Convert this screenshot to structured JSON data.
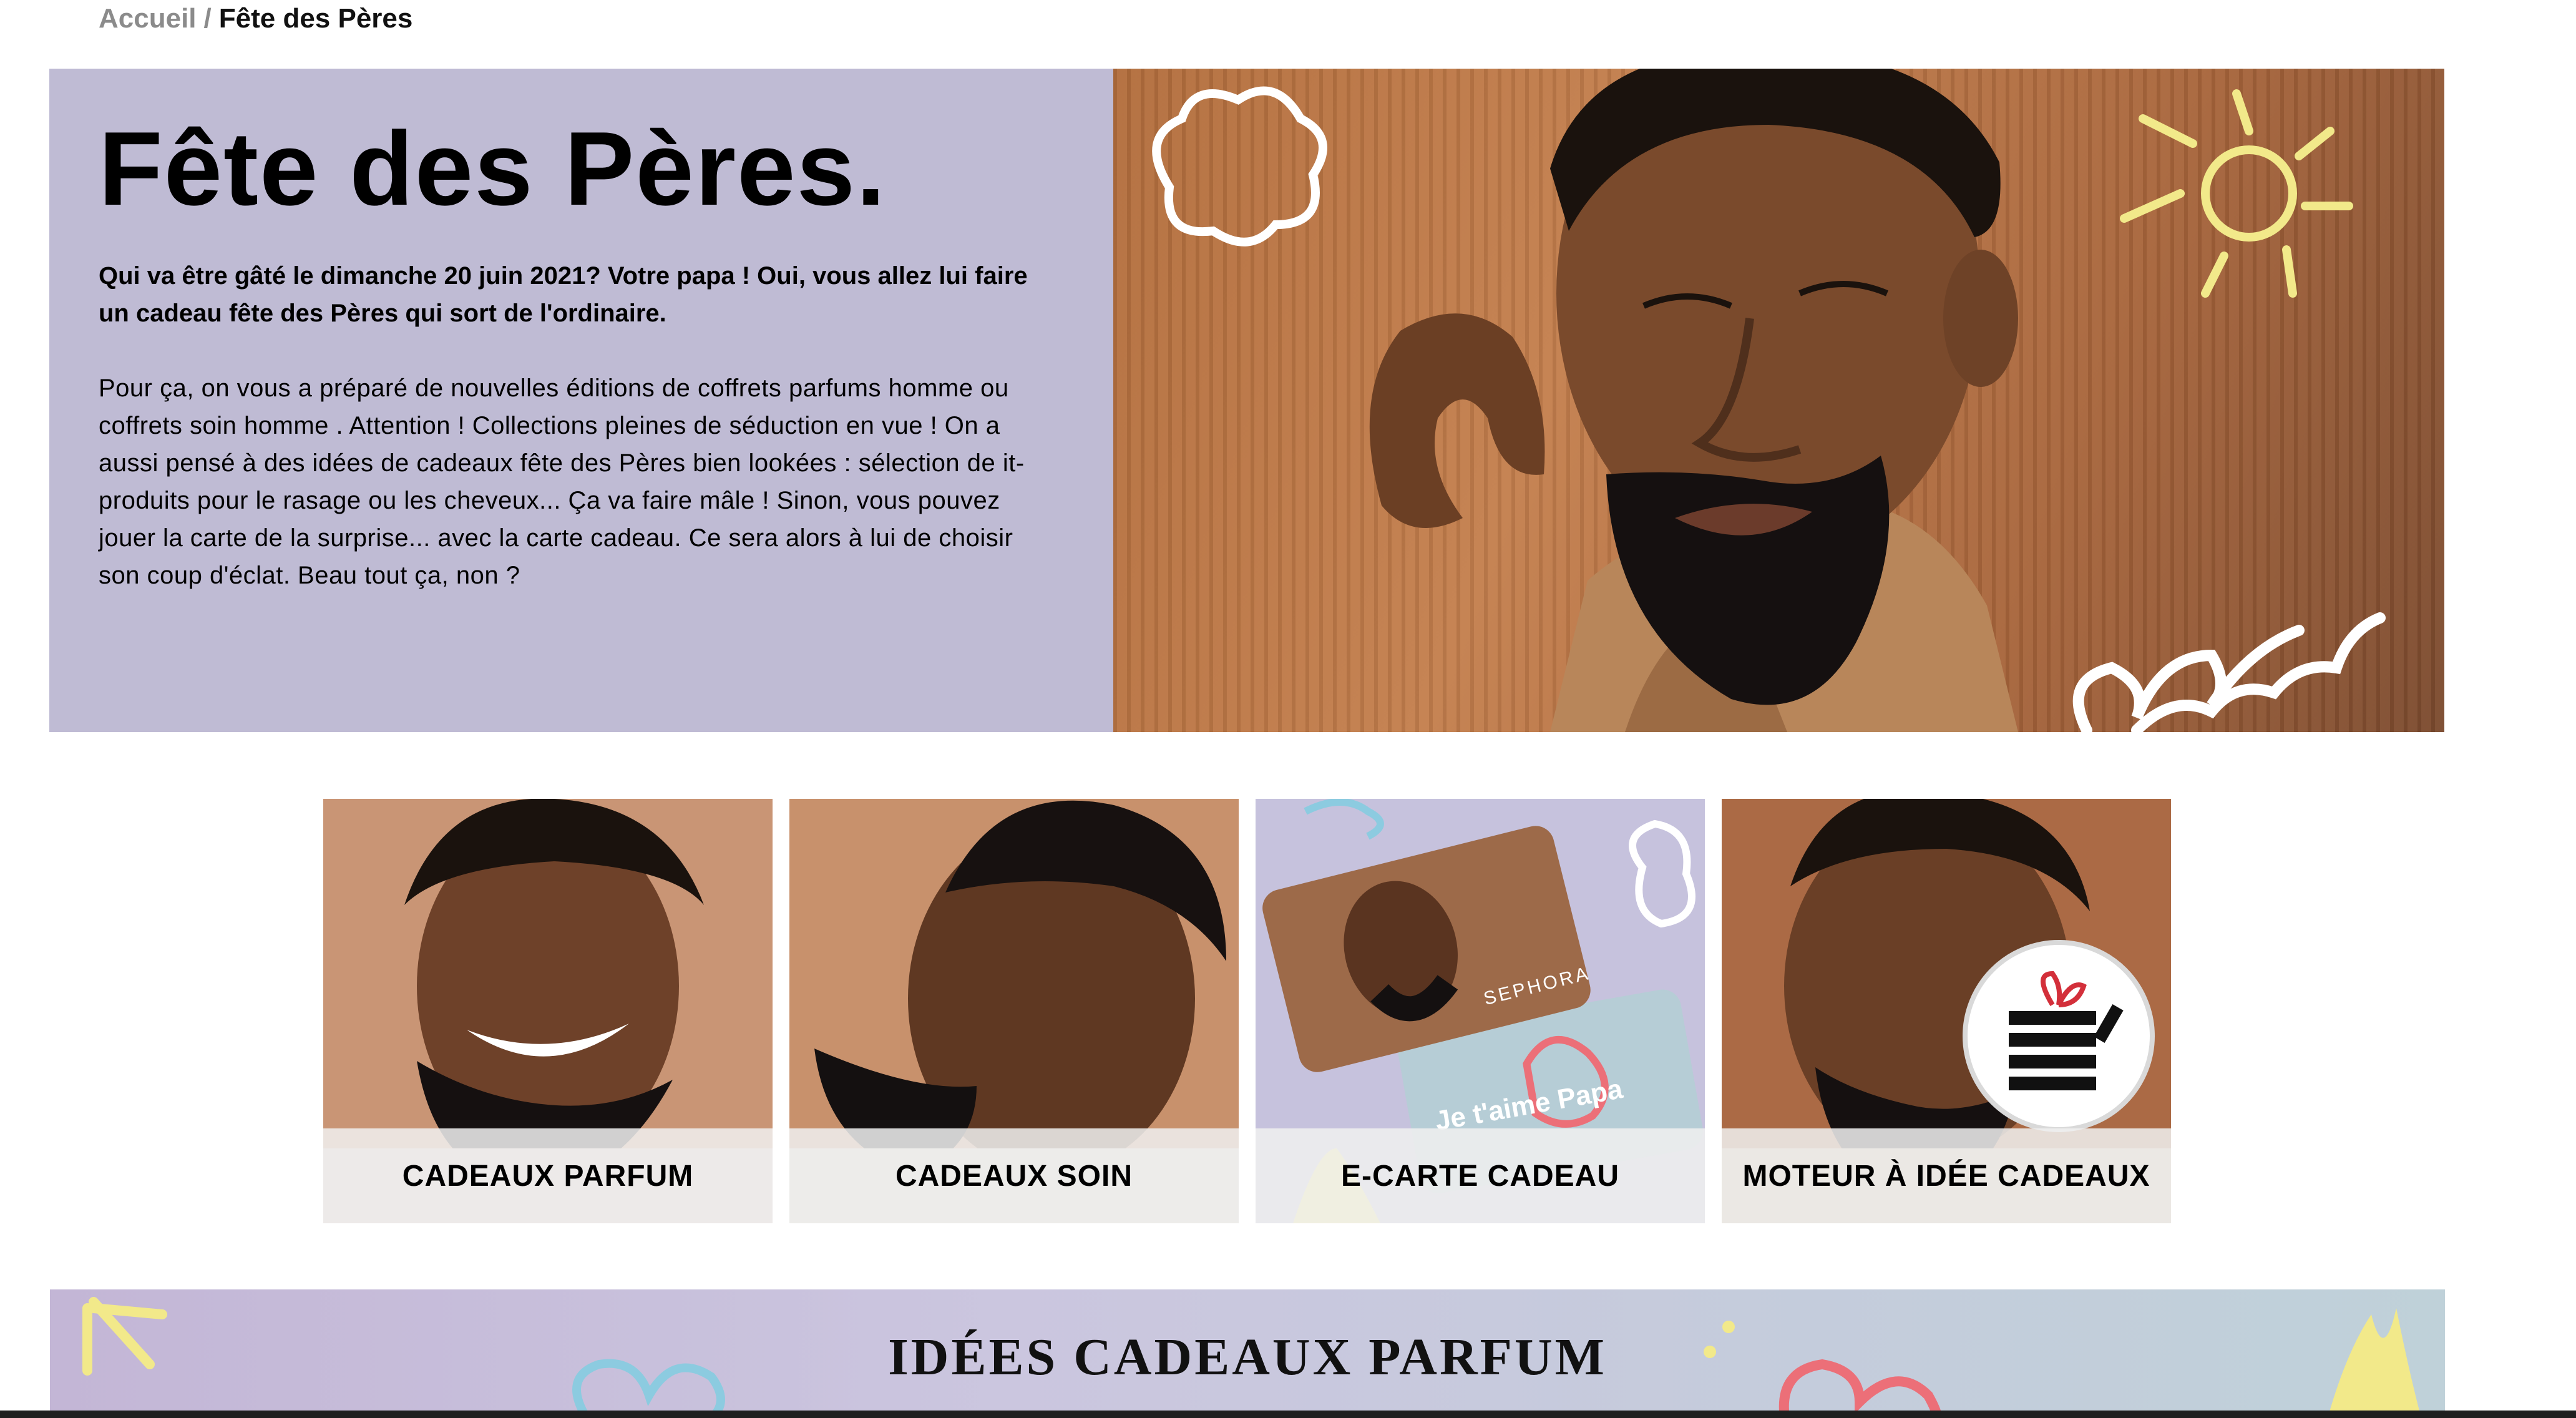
{
  "breadcrumb": {
    "home": "Accueil",
    "separator": "/",
    "current": "Fête des Pères"
  },
  "hero": {
    "title": "Fête des Pères.",
    "lead": "Qui va être gâté le dimanche 20 juin 2021? Votre papa ! Oui, vous allez lui faire un cadeau fête des Pères qui sort de l'ordinaire.",
    "body": "Pour ça, on vous a préparé de nouvelles éditions de coffrets parfums homme ou coffrets soin homme . Attention ! Collections pleines de séduction en vue ! On a aussi pensé à des idées de cadeaux fête des Pères bien lookées : sélection de it-produits pour le rasage ou les cheveux... Ça va faire mâle ! Sinon, vous pouvez jouer la carte de la surprise... avec la carte cadeau. Ce sera alors à lui de choisir son coup d'éclat. Beau tout ça, non ?"
  },
  "cards": [
    {
      "label": "CADEAUX PARFUM"
    },
    {
      "label": "CADEAUX SOIN"
    },
    {
      "label": "E-CARTE CADEAU",
      "gift_card_text": "Je t'aime Papa",
      "gift_card_brand": "SEPHORA"
    },
    {
      "label": "MOTEUR À IDÉE CADEAUX"
    }
  ],
  "banner": {
    "title": "IDÉES CADEAUX PARFUM"
  },
  "colors": {
    "hero_panel": "#bfbbd4",
    "doodle_yellow": "#f2e98a",
    "doodle_blue": "#8ccbe0",
    "doodle_red": "#ec6f78"
  }
}
